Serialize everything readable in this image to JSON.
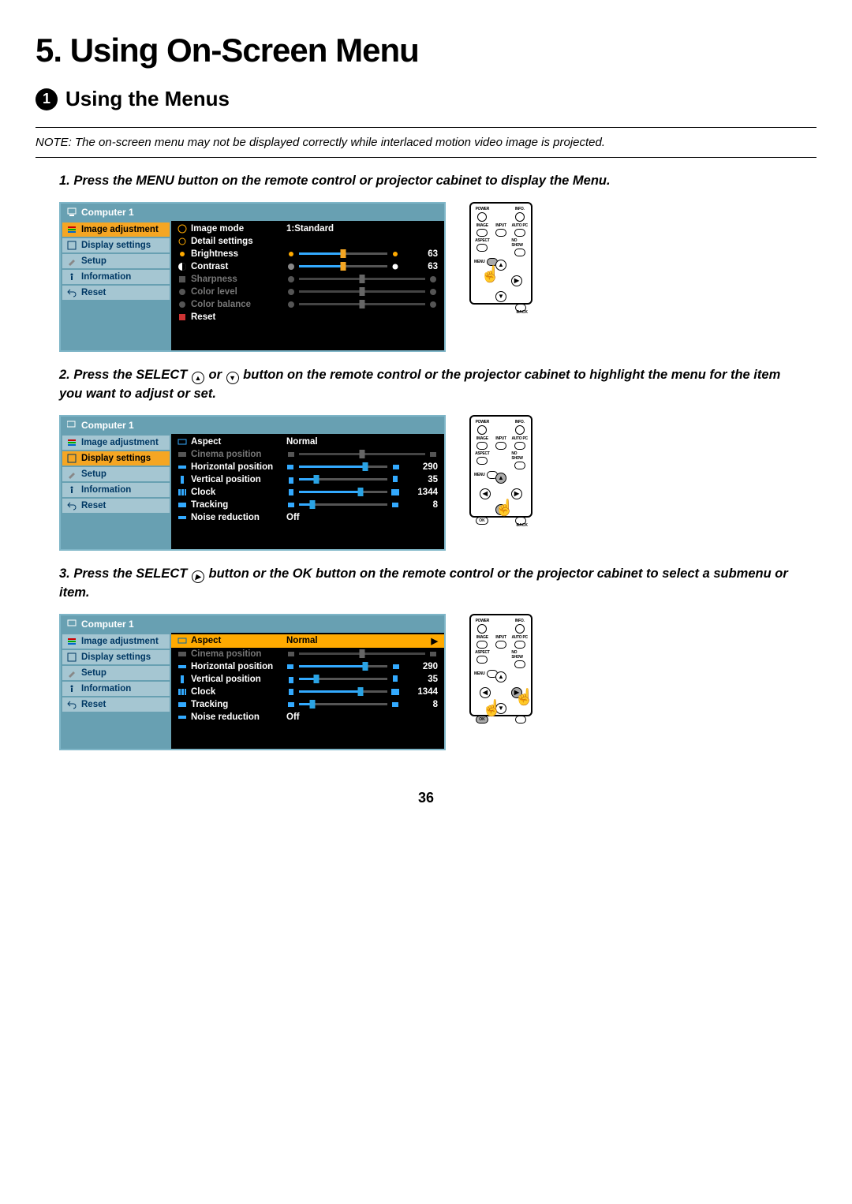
{
  "page": {
    "title": "5. Using On-Screen Menu",
    "section_num": "1",
    "section_title": "Using the Menus",
    "number": "36"
  },
  "note": "NOTE: The on-screen menu may not be displayed correctly while interlaced motion video image is projected.",
  "steps": {
    "s1": "1. Press the MENU button on the remote control or projector cabinet to display the Menu.",
    "s2a": "2. Press the SELECT ",
    "s2b": " or ",
    "s2c": " button on the remote control or the projector cabinet to highlight the menu for the item you want to adjust or set.",
    "s3a": "3. Press the SELECT ",
    "s3b": " button or the OK button on the remote control or the projector cabinet to select a submenu or item."
  },
  "osd_common": {
    "title": "Computer 1"
  },
  "sidebar": {
    "image_adj": "Image adjustment",
    "display": "Display settings",
    "setup": "Setup",
    "info": "Information",
    "reset": "Reset"
  },
  "osd1": {
    "rows": {
      "image_mode": {
        "label": "Image mode",
        "value": "1:Standard"
      },
      "detail": {
        "label": "Detail settings"
      },
      "brightness": {
        "label": "Brightness",
        "num": "63",
        "pos": 50
      },
      "contrast": {
        "label": "Contrast",
        "num": "63",
        "pos": 50
      },
      "sharpness": {
        "label": "Sharpness",
        "pos": 50
      },
      "color_level": {
        "label": "Color level",
        "pos": 50
      },
      "color_balance": {
        "label": "Color balance",
        "pos": 50
      },
      "reset": {
        "label": "Reset"
      }
    }
  },
  "osd2": {
    "rows": {
      "aspect": {
        "label": "Aspect",
        "value": "Normal"
      },
      "cinema": {
        "label": "Cinema position",
        "pos": 50
      },
      "hpos": {
        "label": "Horizontal position",
        "num": "290",
        "pos": 75
      },
      "vpos": {
        "label": "Vertical position",
        "num": "35",
        "pos": 20
      },
      "clock": {
        "label": "Clock",
        "num": "1344",
        "pos": 70
      },
      "tracking": {
        "label": "Tracking",
        "num": "8",
        "pos": 15
      },
      "noise": {
        "label": "Noise reduction",
        "value": "Off"
      }
    }
  },
  "remote": {
    "power": "POWER",
    "info": "INFO.",
    "image": "IMAGE",
    "input": "INPUT",
    "autopc": "AUTO PC",
    "aspect": "ASPECT",
    "noshow": "NO SHOW",
    "menu": "MENU",
    "ok": "OK",
    "back": "BACK"
  }
}
